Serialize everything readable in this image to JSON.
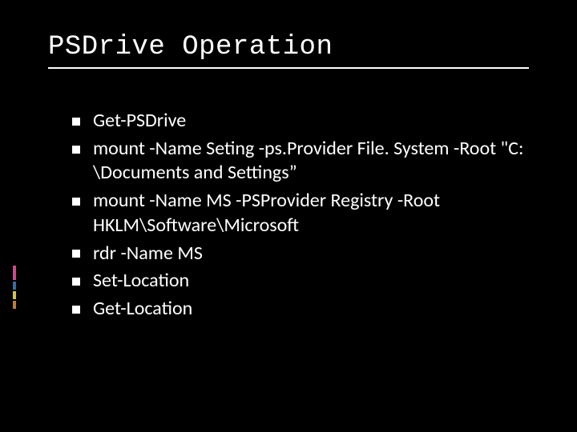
{
  "title": "PSDrive Operation",
  "bullets": [
    "Get-PSDrive",
    "mount -Name Seting -ps.Provider File. System -Root \"C: \\Documents and Settings”",
    "mount -Name MS -PSProvider Registry -Root HKLM\\Software\\Microsoft",
    "rdr -Name MS",
    "Set-Location",
    "Get-Location"
  ]
}
